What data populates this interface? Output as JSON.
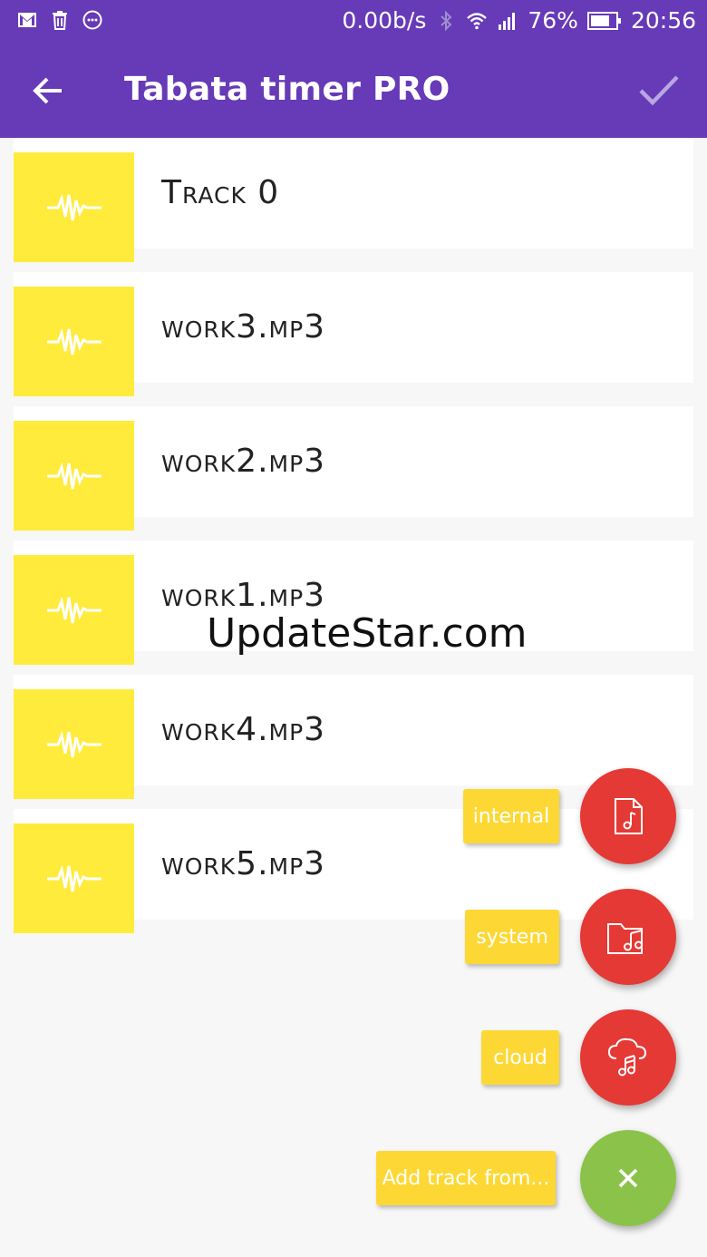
{
  "status_bar": {
    "network_speed": "0.00b/s",
    "battery": "76%",
    "time": "20:56",
    "left_icons": [
      "gmail-icon",
      "trash-icon",
      "more-icon"
    ]
  },
  "app_bar": {
    "title": "Tabata timer PRO",
    "back_icon": "arrow-back-icon",
    "confirm_icon": "check-icon",
    "color": "#673ab7"
  },
  "tracks": [
    {
      "name": "Track 0"
    },
    {
      "name": "work3.mp3"
    },
    {
      "name": "work2.mp3"
    },
    {
      "name": "work1.mp3"
    },
    {
      "name": "work4.mp3"
    },
    {
      "name": "work5.mp3"
    }
  ],
  "watermark": "UpdateStar.com",
  "fab_menu": {
    "internal_label": "internal",
    "system_label": "system",
    "cloud_label": "cloud",
    "add_label": "Add track from...",
    "red_color": "#e53935",
    "green_color": "#8bc34a",
    "label_color": "#fdd835",
    "thumb_color": "#ffeb3b"
  }
}
